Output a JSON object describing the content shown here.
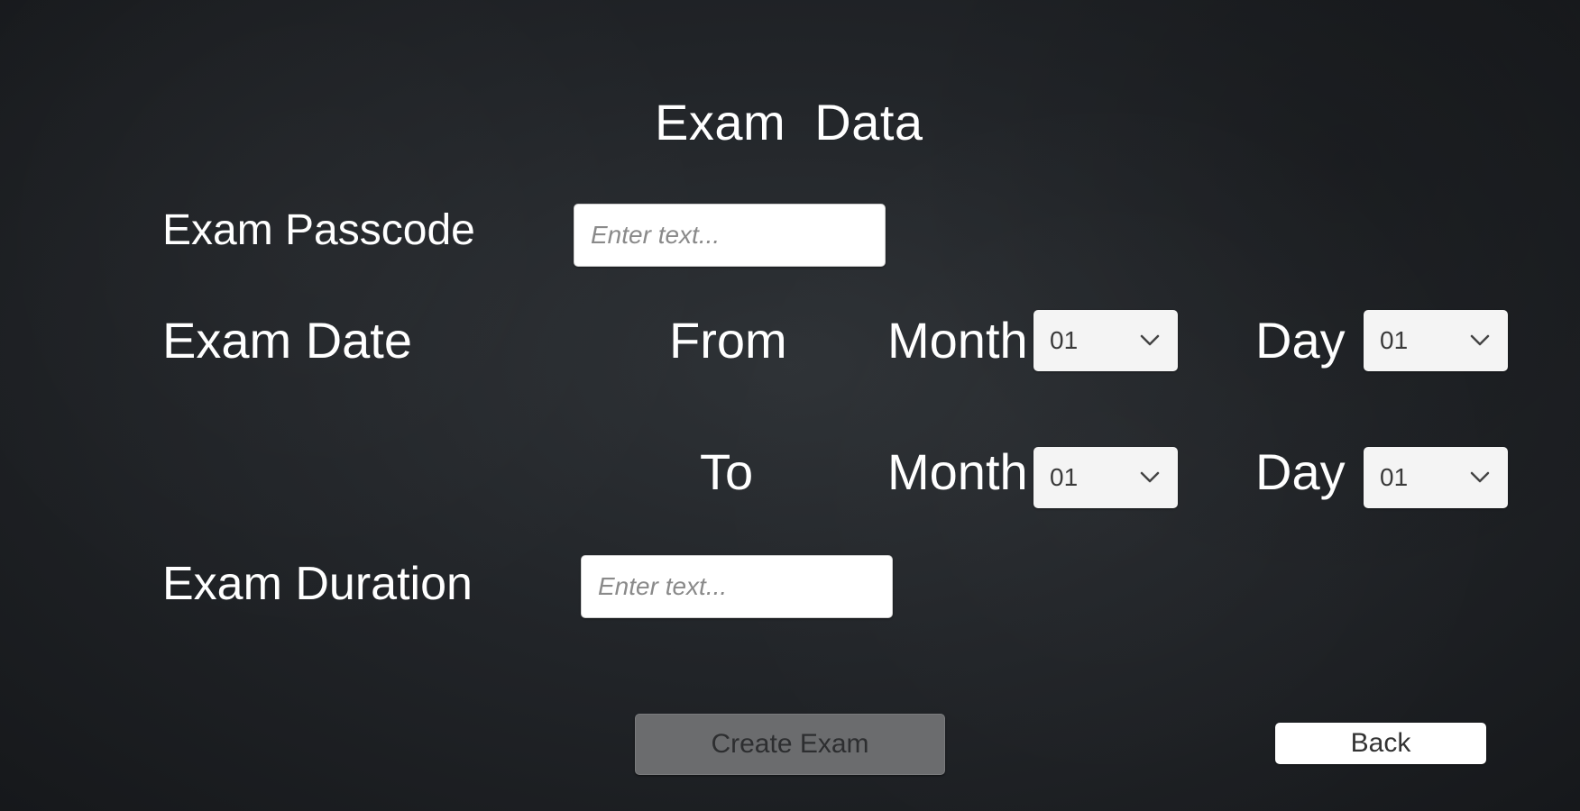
{
  "page": {
    "title": "Exam  Data"
  },
  "form": {
    "passcode": {
      "label": "Exam Passcode",
      "value": "",
      "placeholder": "Enter text..."
    },
    "date": {
      "label": "Exam Date",
      "from": {
        "label": "From",
        "month_label": "Month",
        "month_value": "01",
        "day_label": "Day",
        "day_value": "01"
      },
      "to": {
        "label": "To",
        "month_label": "Month",
        "month_value": "01",
        "day_label": "Day",
        "day_value": "01"
      }
    },
    "duration": {
      "label": "Exam Duration",
      "value": "",
      "placeholder": "Enter text..."
    }
  },
  "actions": {
    "create_label": "Create Exam",
    "back_label": "Back"
  },
  "icons": {
    "dropdown": "chevron-down-icon"
  },
  "colors": {
    "background": "#222529",
    "text": "#ffffff",
    "input_bg": "#ffffff",
    "select_bg": "#f4f4f4",
    "create_button_bg": "#6b6c6e",
    "back_button_bg": "#ffffff"
  }
}
